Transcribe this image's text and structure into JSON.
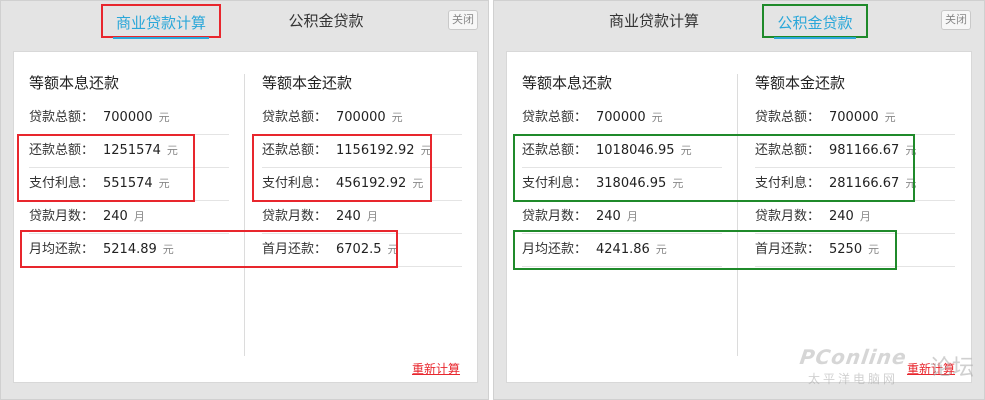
{
  "left": {
    "tabs": [
      "商业贷款计算",
      "公积金贷款"
    ],
    "close_label": "关闭",
    "col1": {
      "title": "等额本息还款",
      "rows": [
        {
          "label": "贷款总额：",
          "value": "700000",
          "unit": "元"
        },
        {
          "label": "还款总额：",
          "value": "1251574",
          "unit": "元"
        },
        {
          "label": "支付利息：",
          "value": "551574",
          "unit": "元"
        },
        {
          "label": "贷款月数：",
          "value": "240",
          "unit": "月"
        },
        {
          "label": "月均还款：",
          "value": "5214.89",
          "unit": "元"
        }
      ]
    },
    "col2": {
      "title": "等额本金还款",
      "rows": [
        {
          "label": "贷款总额：",
          "value": "700000",
          "unit": "元"
        },
        {
          "label": "还款总额：",
          "value": "1156192.92",
          "unit": "元"
        },
        {
          "label": "支付利息：",
          "value": "456192.92",
          "unit": "元"
        },
        {
          "label": "贷款月数：",
          "value": "240",
          "unit": "月"
        },
        {
          "label": "首月还款：",
          "value": "6702.5",
          "unit": "元"
        }
      ]
    },
    "recalc_label": "重新计算"
  },
  "right": {
    "tabs": [
      "商业贷款计算",
      "公积金贷款"
    ],
    "close_label": "关闭",
    "col1": {
      "title": "等额本息还款",
      "rows": [
        {
          "label": "贷款总额：",
          "value": "700000",
          "unit": "元"
        },
        {
          "label": "还款总额：",
          "value": "1018046.95",
          "unit": "元"
        },
        {
          "label": "支付利息：",
          "value": "318046.95",
          "unit": "元"
        },
        {
          "label": "贷款月数：",
          "value": "240",
          "unit": "月"
        },
        {
          "label": "月均还款：",
          "value": "4241.86",
          "unit": "元"
        }
      ]
    },
    "col2": {
      "title": "等额本金还款",
      "rows": [
        {
          "label": "贷款总额：",
          "value": "700000",
          "unit": "元"
        },
        {
          "label": "还款总额：",
          "value": "981166.67",
          "unit": "元"
        },
        {
          "label": "支付利息：",
          "value": "281166.67",
          "unit": "元"
        },
        {
          "label": "贷款月数：",
          "value": "240",
          "unit": "月"
        },
        {
          "label": "首月还款：",
          "value": "5250",
          "unit": "元"
        }
      ]
    },
    "recalc_label": "重新计算"
  },
  "watermark": {
    "brand": "PConline",
    "forum": "论坛",
    "sub": "太平洋电脑网"
  },
  "colors": {
    "accent": "#2aa7d9",
    "highlight_red": "#e8262d",
    "highlight_green": "#1f8a2a"
  }
}
